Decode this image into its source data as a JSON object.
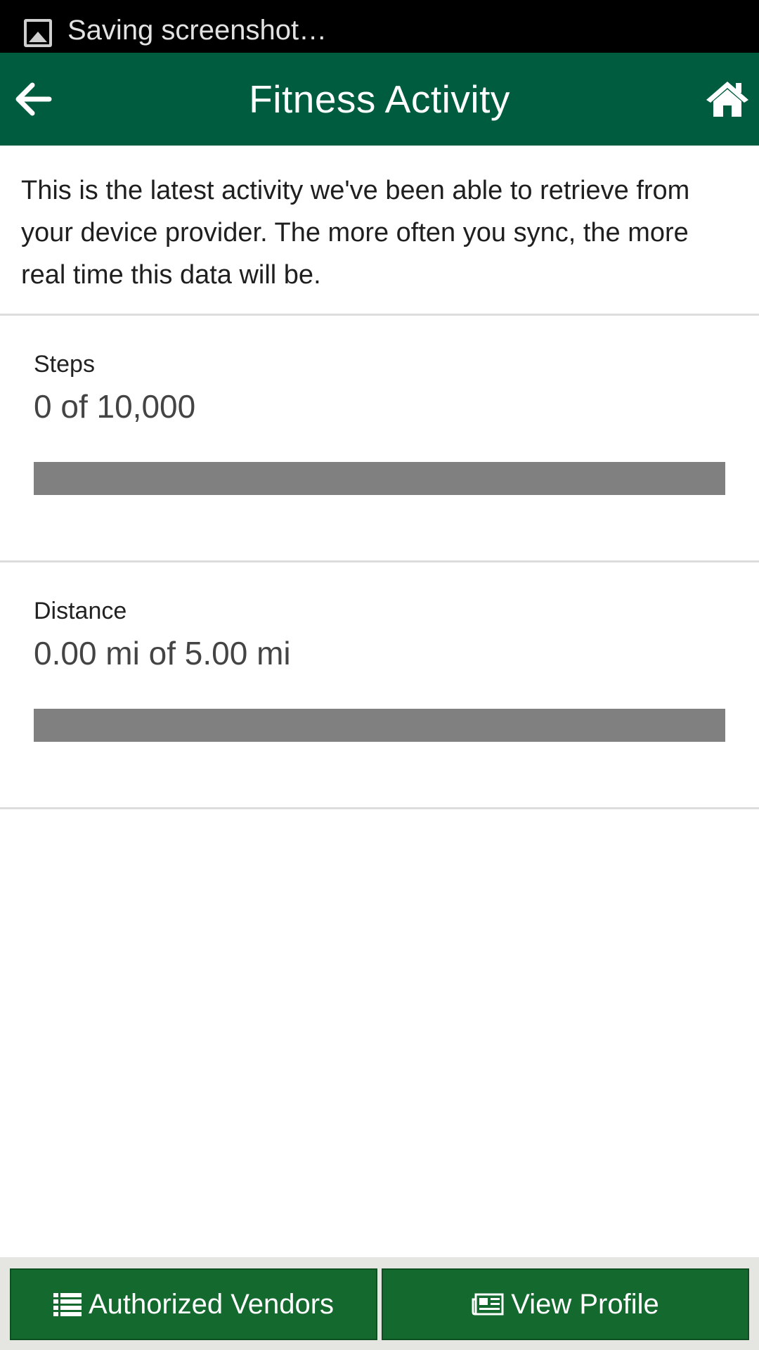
{
  "status_bar": {
    "notification_text": "Saving screenshot…",
    "notification_icon": "image-icon"
  },
  "header": {
    "title": "Fitness Activity",
    "back_icon": "arrow-left-icon",
    "home_icon": "home-icon",
    "background_color": "#005c3e"
  },
  "intro_text": "This is the latest activity we've been able to retrieve from your device provider. The more often you sync, the more real time this data will be.",
  "metrics": [
    {
      "label": "Steps",
      "value_text": "0 of 10,000",
      "progress": 0
    },
    {
      "label": "Distance",
      "value_text": "0.00 mi of 5.00 mi",
      "progress": 0
    }
  ],
  "footer": {
    "buttons": [
      {
        "label": "Authorized Vendors",
        "icon": "list-icon"
      },
      {
        "label": "View Profile",
        "icon": "newspaper-icon"
      }
    ],
    "button_color": "#146a2e"
  }
}
